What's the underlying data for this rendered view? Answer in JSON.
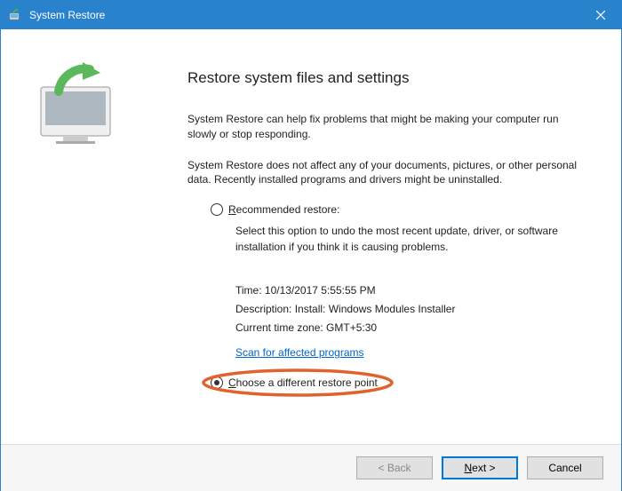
{
  "titlebar": {
    "title": "System Restore"
  },
  "content": {
    "heading": "Restore system files and settings",
    "para1": "System Restore can help fix problems that might be making your computer run slowly or stop responding.",
    "para2": "System Restore does not affect any of your documents, pictures, or other personal data. Recently installed programs and drivers might be uninstalled.",
    "recommended": {
      "label_prefix": "R",
      "label_rest": "ecommended restore:",
      "detail": "Select this option to undo the most recent update, driver, or software installation if you think it is causing problems.",
      "time_label": "Time: ",
      "time_value": "10/13/2017 5:55:55 PM",
      "desc_label": "Description: ",
      "desc_value": "Install: Windows Modules Installer",
      "tz_label": "Current time zone: ",
      "tz_value": "GMT+5:30",
      "scan_link": "Scan for affected programs"
    },
    "choose": {
      "label_prefix": "C",
      "label_rest": "hoose a different restore point"
    }
  },
  "footer": {
    "back": "< Back",
    "next": "Next >",
    "cancel": "Cancel"
  }
}
